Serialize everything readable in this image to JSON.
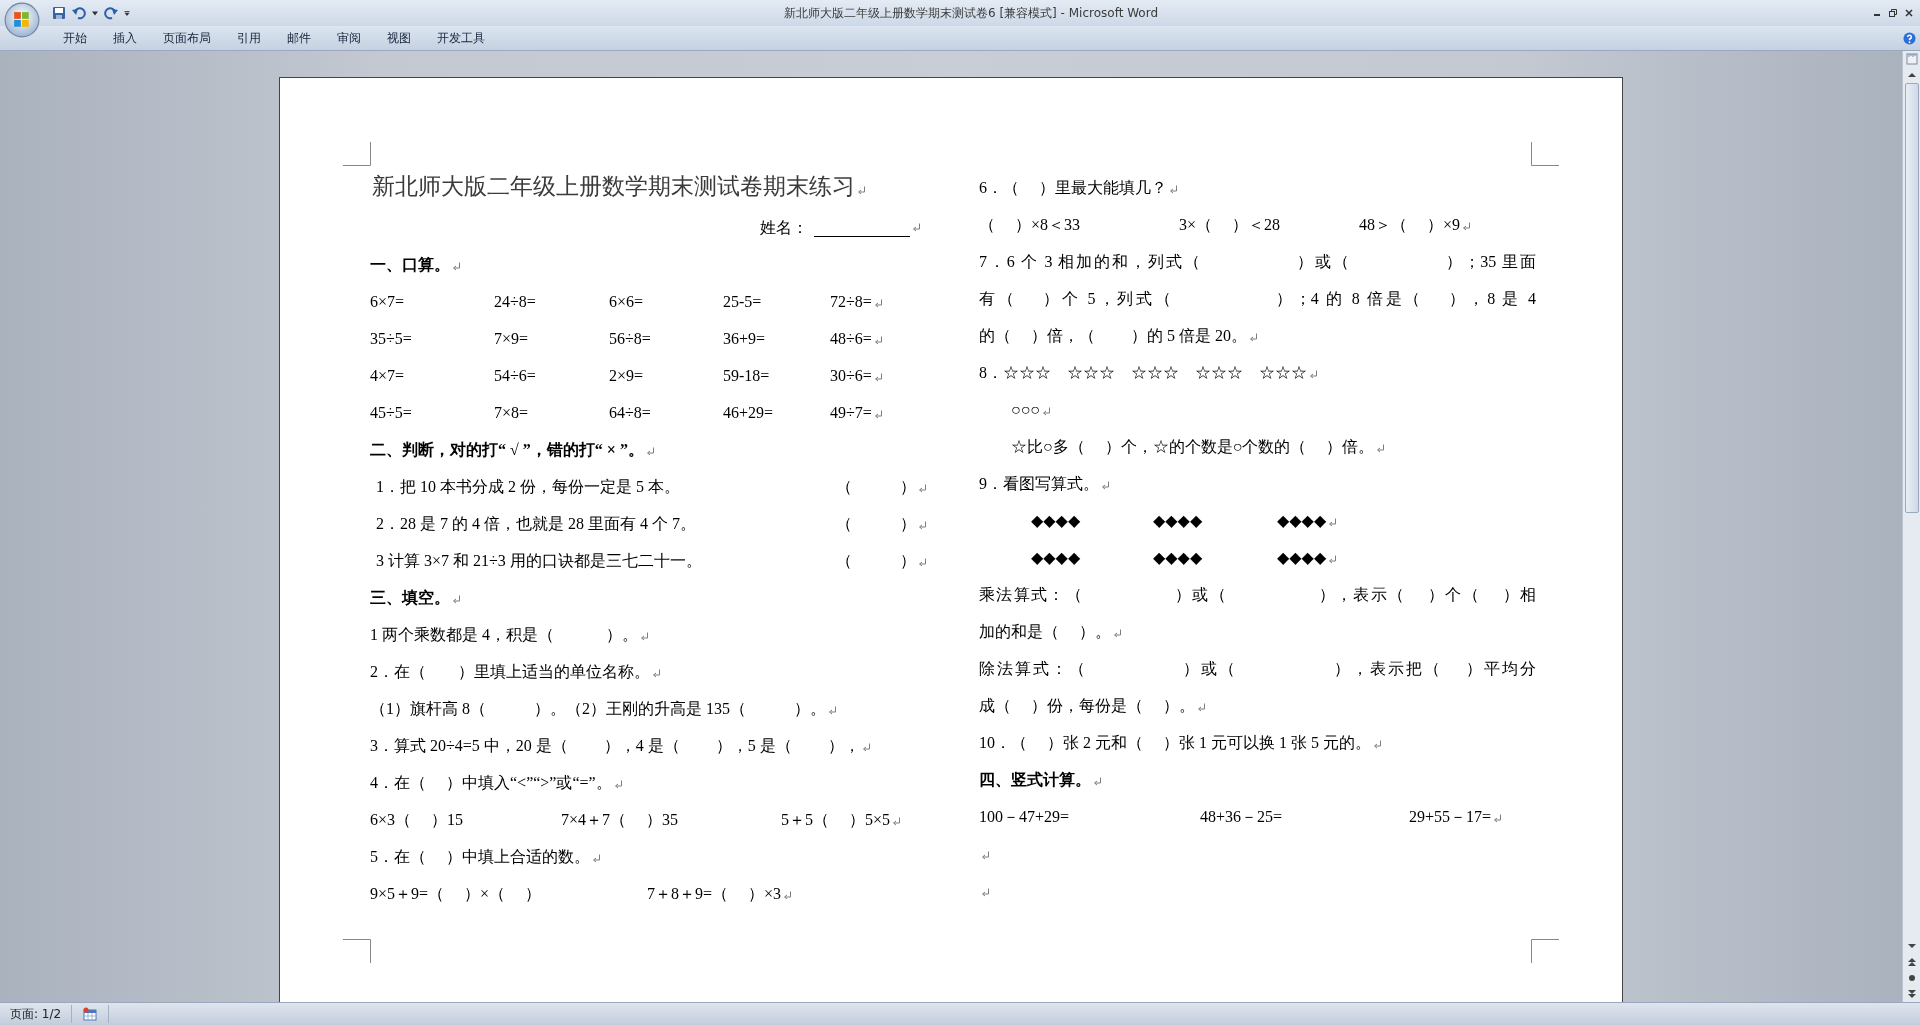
{
  "window": {
    "title": "新北师大版二年级上册数学期末测试卷6 [兼容模式] - Microsoft Word"
  },
  "ribbon": {
    "tabs": [
      {
        "label": "开始",
        "selected": false
      },
      {
        "label": "插入",
        "selected": false
      },
      {
        "label": "页面布局",
        "selected": false
      },
      {
        "label": "引用",
        "selected": false
      },
      {
        "label": "邮件",
        "selected": false
      },
      {
        "label": "审阅",
        "selected": false
      },
      {
        "label": "视图",
        "selected": false
      },
      {
        "label": "开发工具",
        "selected": false
      }
    ]
  },
  "document": {
    "columns": [
      [
        {
          "kind": "title",
          "text": "新北师大版二年级上册数学期末测试卷期末练习",
          "end_mark": true
        },
        {
          "kind": "name",
          "text": "姓名：",
          "end_mark": true
        },
        {
          "kind": "heading",
          "text": "一、口算。",
          "end_mark": true
        },
        {
          "kind": "calc",
          "parts": [
            "6×7=",
            "24÷8=",
            "6×6=",
            "25-5=",
            "72÷8="
          ],
          "end_mark": true
        },
        {
          "kind": "calc",
          "parts": [
            "35÷5=",
            "7×9=",
            "56÷8=",
            "36+9=",
            "48÷6="
          ],
          "end_mark": true
        },
        {
          "kind": "calc",
          "parts": [
            "4×7=",
            "54÷6=",
            "2×9=",
            "59-18=",
            "30÷6="
          ],
          "end_mark": true
        },
        {
          "kind": "calc",
          "parts": [
            "45÷5=",
            "7×8=",
            "64÷8=",
            "46+29=",
            "49÷7="
          ],
          "end_mark": true
        },
        {
          "kind": "heading",
          "text": "二、判断，对的打“ √ ”，错的打“ × ”。",
          "end_mark": true
        },
        {
          "kind": "judge",
          "parts": [
            "1．把 10 本书分成 2 份，每份一定是 5 本。",
            "（　　　）"
          ],
          "end_mark": true
        },
        {
          "kind": "judge",
          "parts": [
            "2．28 是 7 的 4 倍，也就是 28 里面有 4 个 7。",
            "（　　　）"
          ],
          "end_mark": true
        },
        {
          "kind": "judge",
          "parts": [
            "3 计算 3×7 和 21÷3 用的口诀都是三七二十一。",
            "（　　　）"
          ],
          "end_mark": true
        },
        {
          "kind": "heading",
          "text": "三、填空。",
          "end_mark": true
        },
        {
          "kind": "text",
          "text": "1 两个乘数都是 4，积是（　　　 ）。",
          "end_mark": true
        },
        {
          "kind": "text",
          "text": "2．在（　　）里填上适当的单位名称。",
          "end_mark": true
        },
        {
          "kind": "text",
          "text": "（1）旗杆高 8（　　　）。（2）王刚的升高是 135（　　　）。",
          "end_mark": true
        },
        {
          "kind": "text",
          "text": "3．算式 20÷4=5 中，20 是（　　 ），4 是（　　 ），5 是（　　 ），",
          "end_mark": true
        },
        {
          "kind": "text",
          "text": "4．在（　 ）中填入“<”“>”或“=”。",
          "end_mark": true
        },
        {
          "kind": "compare",
          "parts": [
            "6×3（　 ）15",
            "7×4＋7（　 ）35",
            "5＋5（　 ）5×5"
          ],
          "end_mark": true
        },
        {
          "kind": "text",
          "text": "5．在（　 ）中填上合适的数。",
          "end_mark": true
        },
        {
          "kind": "pair",
          "parts": [
            "9×5＋9=（　 ）×（　 ）",
            "7＋8＋9=（　 ）×3"
          ],
          "end_mark": true
        }
      ],
      [
        {
          "kind": "text",
          "text": "6．（　 ）里最大能填几？",
          "end_mark": true
        },
        {
          "kind": "bounds",
          "parts": [
            "（　 ）×8＜33",
            "3×（　 ）＜28",
            "48＞（　 ）×9"
          ],
          "end_mark": true
        },
        {
          "kind": "wrap",
          "text": "7．6 个 3 相加的和，列式（　　　　　 ）或（　　　　　 ）；35 里面"
        },
        {
          "kind": "wrap",
          "text": "有（　 ）个 5，列式（　　　　　 ）；4 的 8 倍是（　 ），8 是 4"
        },
        {
          "kind": "text",
          "text": "的（　 ）倍，（　　 ）的 5 倍是 20。",
          "end_mark": true
        },
        {
          "kind": "text",
          "text": "8．☆☆☆　☆☆☆　☆☆☆　☆☆☆　☆☆☆",
          "end_mark": true
        },
        {
          "kind": "indent",
          "text": "○○○",
          "end_mark": true
        },
        {
          "kind": "indent",
          "text": "☆比○多（　 ）个，☆的个数是○个数的（　 ）倍。",
          "end_mark": true
        },
        {
          "kind": "text",
          "text": "9．看图写算式。",
          "end_mark": true
        },
        {
          "kind": "diamonds",
          "parts": [
            "◆◆◆◆",
            "◆◆◆◆",
            "◆◆◆◆"
          ],
          "end_mark": true
        },
        {
          "kind": "diamonds",
          "parts": [
            "◆◆◆◆",
            "◆◆◆◆",
            "◆◆◆◆"
          ],
          "end_mark": true
        },
        {
          "kind": "wrap",
          "text": "乘法算式：（　　　　　 ）或（　　　　　 ），表示（　 ）个（　 ）相"
        },
        {
          "kind": "text",
          "text": "加的和是（　 ）。",
          "end_mark": true
        },
        {
          "kind": "wrap",
          "text": "除法算式：（　　　　　 ）或（　　　　　 ），表示把（　 ）平均分"
        },
        {
          "kind": "text",
          "text": "成（　 ）份，每份是（　 ）。",
          "end_mark": true
        },
        {
          "kind": "text",
          "text": "10．（　 ）张 2 元和（　 ）张 1 元可以换 1 张 5 元的。",
          "end_mark": true
        },
        {
          "kind": "heading",
          "text": "四、竖式计算。",
          "end_mark": true
        },
        {
          "kind": "vertical",
          "parts": [
            "100－47+29=",
            "48+36－25=",
            "29+55－17="
          ],
          "end_mark": true
        },
        {
          "kind": "blank",
          "end_mark": true
        },
        {
          "kind": "blank",
          "end_mark": true
        }
      ]
    ]
  },
  "status_bar": {
    "page": "页面: 1/2"
  }
}
